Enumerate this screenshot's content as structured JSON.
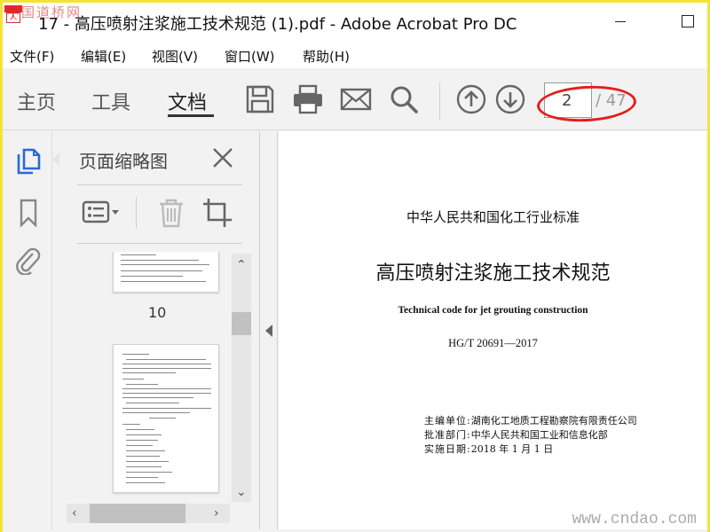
{
  "window": {
    "title": "17 - 高压喷射注浆施工技术规范 (1).pdf - Adobe Acrobat Pro DC",
    "watermark_top": "中国道桥网",
    "logo_glyph": "人"
  },
  "menu": {
    "items": [
      "文件(F)",
      "编辑(E)",
      "视图(V)",
      "窗口(W)",
      "帮助(H)"
    ]
  },
  "toolbar": {
    "tabs": [
      "主页",
      "工具",
      "文档"
    ],
    "active_tab": "文档",
    "icons": [
      "save-icon",
      "print-icon",
      "email-icon",
      "search-icon",
      "page-up-icon",
      "page-down-icon"
    ],
    "current_page": "2",
    "total_pages": "/ 47"
  },
  "left_rail": {
    "icons": [
      "page-thumbnails-icon",
      "bookmark-icon",
      "attachment-icon"
    ],
    "active_color": "#2a6ad1"
  },
  "thumb_panel": {
    "title": "页面缩略图",
    "tools": [
      "options-menu-icon",
      "delete-icon",
      "crop-icon"
    ],
    "thumbnails": [
      {
        "label": "10"
      }
    ]
  },
  "document": {
    "standard_line": "中华人民共和国化工行业标准",
    "title": "高压喷射注浆施工技术规范",
    "title_en": "Technical code for jet grouting construction",
    "code": "HG/T 20691—2017",
    "meta": [
      {
        "key": "主编单位:",
        "value": "湖南化工地质工程勘察院有限责任公司"
      },
      {
        "key": "批准部门:",
        "value": "中华人民共和国工业和信息化部"
      },
      {
        "key": "实施日期:",
        "value": "2018 年 1 月 1 日"
      }
    ],
    "watermark_bottom": "www.cndao.com"
  },
  "colors": {
    "border": "#f3e337",
    "highlight_ellipse": "#e0201a",
    "active_icon": "#2a6ad1"
  }
}
